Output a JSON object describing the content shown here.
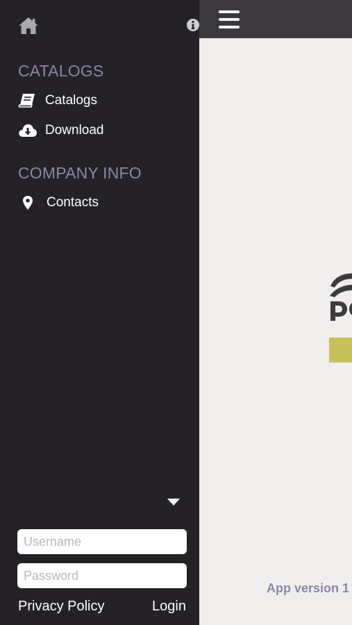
{
  "sidebar": {
    "sections": [
      {
        "title": "CATALOGS",
        "items": [
          {
            "label": "Catalogs",
            "icon": "book-icon"
          },
          {
            "label": "Download",
            "icon": "cloud-download-icon"
          }
        ]
      },
      {
        "title": "COMPANY INFO",
        "items": [
          {
            "label": "Contacts",
            "icon": "map-pin-icon"
          }
        ]
      }
    ],
    "login": {
      "username_placeholder": "Username",
      "password_placeholder": "Password",
      "privacy_label": "Privacy Policy",
      "login_label": "Login"
    }
  },
  "main": {
    "app_version": "App version 1"
  },
  "colors": {
    "sidebar_bg": "#242227",
    "section_title": "#8e86a8",
    "topbar_bg": "#3b393d",
    "content_bg": "#efeeec",
    "accent": "#c6c15a"
  }
}
